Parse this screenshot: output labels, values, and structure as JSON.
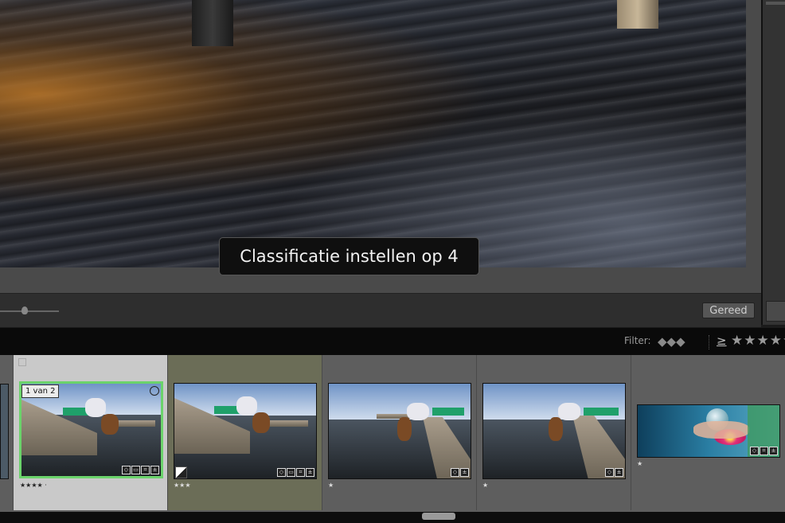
{
  "toast": {
    "text": "Classificatie instellen op 4"
  },
  "toolbar": {
    "done_label": "Gereed",
    "zoom_slider_level": 0.38
  },
  "filter_bar": {
    "label": "Filter:",
    "operator": "≥",
    "stars": "★★★★★"
  },
  "filmstrip": {
    "selection_count": "1 van 2",
    "thumbnails": [
      {
        "rating": "★★★★ ·",
        "selected": true
      },
      {
        "rating": "★★★",
        "selected": true
      },
      {
        "rating": "★",
        "selected": false
      },
      {
        "rating": "★",
        "selected": false
      },
      {
        "rating": "★",
        "selected": false
      }
    ]
  },
  "icons": [
    "keyword-badge-icon",
    "stack-badge-icon",
    "crop-badge-icon",
    "develop-badge-icon",
    "flip-icon",
    "circle-icon"
  ]
}
